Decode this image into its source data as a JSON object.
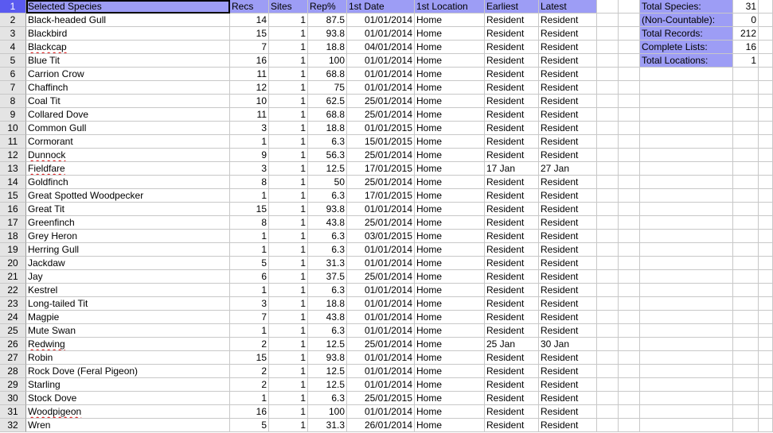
{
  "headers": [
    "Selected Species",
    "Recs",
    "Sites",
    "Rep%",
    "1st Date",
    "1st Location",
    "Earliest",
    "Latest"
  ],
  "rows": [
    [
      "Black-headed Gull",
      "14",
      "1",
      "87.5",
      "01/01/2014",
      "Home",
      "Resident",
      "Resident"
    ],
    [
      "Blackbird",
      "15",
      "1",
      "93.8",
      "01/01/2014",
      "Home",
      "Resident",
      "Resident"
    ],
    [
      "Blackcap",
      "7",
      "1",
      "18.8",
      "04/01/2014",
      "Home",
      "Resident",
      "Resident"
    ],
    [
      "Blue Tit",
      "16",
      "1",
      "100",
      "01/01/2014",
      "Home",
      "Resident",
      "Resident"
    ],
    [
      "Carrion Crow",
      "11",
      "1",
      "68.8",
      "01/01/2014",
      "Home",
      "Resident",
      "Resident"
    ],
    [
      "Chaffinch",
      "12",
      "1",
      "75",
      "01/01/2014",
      "Home",
      "Resident",
      "Resident"
    ],
    [
      "Coal Tit",
      "10",
      "1",
      "62.5",
      "25/01/2014",
      "Home",
      "Resident",
      "Resident"
    ],
    [
      "Collared Dove",
      "11",
      "1",
      "68.8",
      "25/01/2014",
      "Home",
      "Resident",
      "Resident"
    ],
    [
      "Common Gull",
      "3",
      "1",
      "18.8",
      "01/01/2015",
      "Home",
      "Resident",
      "Resident"
    ],
    [
      "Cormorant",
      "1",
      "1",
      "6.3",
      "15/01/2015",
      "Home",
      "Resident",
      "Resident"
    ],
    [
      "Dunnock",
      "9",
      "1",
      "56.3",
      "25/01/2014",
      "Home",
      "Resident",
      "Resident"
    ],
    [
      "Fieldfare",
      "3",
      "1",
      "12.5",
      "17/01/2015",
      "Home",
      "17 Jan",
      "27 Jan"
    ],
    [
      "Goldfinch",
      "8",
      "1",
      "50",
      "25/01/2014",
      "Home",
      "Resident",
      "Resident"
    ],
    [
      "Great Spotted Woodpecker",
      "1",
      "1",
      "6.3",
      "17/01/2015",
      "Home",
      "Resident",
      "Resident"
    ],
    [
      "Great Tit",
      "15",
      "1",
      "93.8",
      "01/01/2014",
      "Home",
      "Resident",
      "Resident"
    ],
    [
      "Greenfinch",
      "8",
      "1",
      "43.8",
      "25/01/2014",
      "Home",
      "Resident",
      "Resident"
    ],
    [
      "Grey Heron",
      "1",
      "1",
      "6.3",
      "03/01/2015",
      "Home",
      "Resident",
      "Resident"
    ],
    [
      "Herring Gull",
      "1",
      "1",
      "6.3",
      "01/01/2014",
      "Home",
      "Resident",
      "Resident"
    ],
    [
      "Jackdaw",
      "5",
      "1",
      "31.3",
      "01/01/2014",
      "Home",
      "Resident",
      "Resident"
    ],
    [
      "Jay",
      "6",
      "1",
      "37.5",
      "25/01/2014",
      "Home",
      "Resident",
      "Resident"
    ],
    [
      "Kestrel",
      "1",
      "1",
      "6.3",
      "01/01/2014",
      "Home",
      "Resident",
      "Resident"
    ],
    [
      "Long-tailed Tit",
      "3",
      "1",
      "18.8",
      "01/01/2014",
      "Home",
      "Resident",
      "Resident"
    ],
    [
      "Magpie",
      "7",
      "1",
      "43.8",
      "01/01/2014",
      "Home",
      "Resident",
      "Resident"
    ],
    [
      "Mute Swan",
      "1",
      "1",
      "6.3",
      "01/01/2014",
      "Home",
      "Resident",
      "Resident"
    ],
    [
      "Redwing",
      "2",
      "1",
      "12.5",
      "25/01/2014",
      "Home",
      "25 Jan",
      "30 Jan"
    ],
    [
      "Robin",
      "15",
      "1",
      "93.8",
      "01/01/2014",
      "Home",
      "Resident",
      "Resident"
    ],
    [
      "Rock Dove (Feral Pigeon)",
      "2",
      "1",
      "12.5",
      "01/01/2014",
      "Home",
      "Resident",
      "Resident"
    ],
    [
      "Starling",
      "2",
      "1",
      "12.5",
      "01/01/2014",
      "Home",
      "Resident",
      "Resident"
    ],
    [
      "Stock Dove",
      "1",
      "1",
      "6.3",
      "25/01/2015",
      "Home",
      "Resident",
      "Resident"
    ],
    [
      "Woodpigeon",
      "16",
      "1",
      "100",
      "01/01/2014",
      "Home",
      "Resident",
      "Resident"
    ],
    [
      "Wren",
      "5",
      "1",
      "31.3",
      "26/01/2014",
      "Home",
      "Resident",
      "Resident"
    ]
  ],
  "spellcheck_flagged": [
    "Blackcap",
    "Dunnock",
    "Fieldfare",
    "Redwing",
    "Woodpigeon"
  ],
  "summary": [
    {
      "label": "Total Species:",
      "value": "31"
    },
    {
      "label": "(Non-Countable):",
      "value": "0"
    },
    {
      "label": "Total Records:",
      "value": "212"
    },
    {
      "label": "Complete Lists:",
      "value": "16"
    },
    {
      "label": "Total Locations:",
      "value": "1"
    }
  ],
  "row_count": 32,
  "active_cell": "A1",
  "colors": {
    "header_fill": "#9d9df5",
    "selected_row_header": "#5a5af0",
    "gridline": "#c8c8c8",
    "spellcheck": "#d22222"
  }
}
